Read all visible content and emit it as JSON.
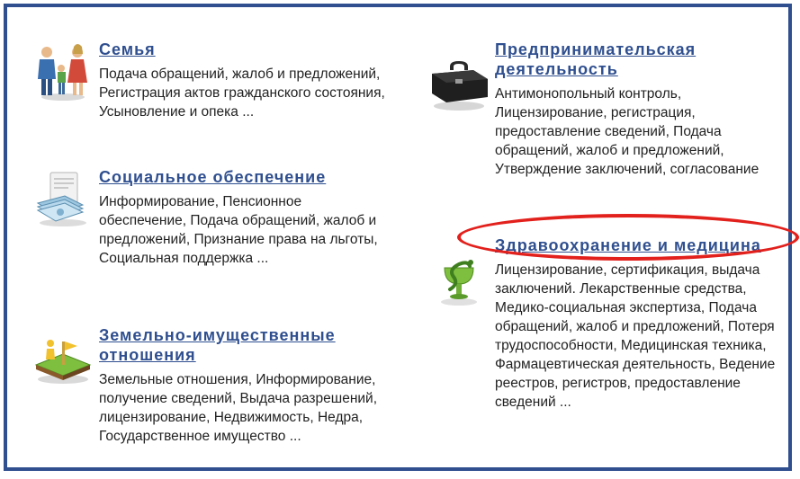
{
  "categories": {
    "left": [
      {
        "title": "Семья",
        "description": "Подача обращений, жалоб и предложений, Регистрация актов гражданского состояния, Усыновление и опека ...",
        "icon": "family-icon"
      },
      {
        "title": "Социальное обеспечение",
        "description": "Информирование, Пенсионное обеспечение, Подача обращений, жалоб и предложений, Признание права на льготы, Социальная поддержка ...",
        "icon": "documents-money-icon"
      },
      {
        "title": "Земельно-имущественные отношения",
        "description": "Земельные отношения, Информирование, получение сведений, Выдача разрешений, лицензирование, Недвижимость, Недра, Государственное имущество ...",
        "icon": "land-plot-icon"
      }
    ],
    "right": [
      {
        "title": "Предпринимательская деятельность",
        "description": "Антимонопольный контроль, Лицензирование, регистрация, предоставление сведений, Подача обращений, жалоб и предложений, Утверждение заключений, согласование",
        "icon": "briefcase-icon"
      },
      {
        "title": "Здравоохранение и медицина",
        "description": "Лицензирование, сертификация, выдача заключений. Лекарственные средства, Медико-социальная экспертиза, Подача обращений, жалоб и предложений, Потеря трудоспособности, Медицинская техника, Фармацевтическая деятельность, Ведение реестров, регистров, предоставление сведений ...",
        "icon": "medicine-snake-bowl-icon"
      }
    ]
  },
  "colors": {
    "frame_border": "#2f4f8f",
    "title_link": "#2f4f8f",
    "description_text": "#222222",
    "highlight": "#e2201c"
  }
}
